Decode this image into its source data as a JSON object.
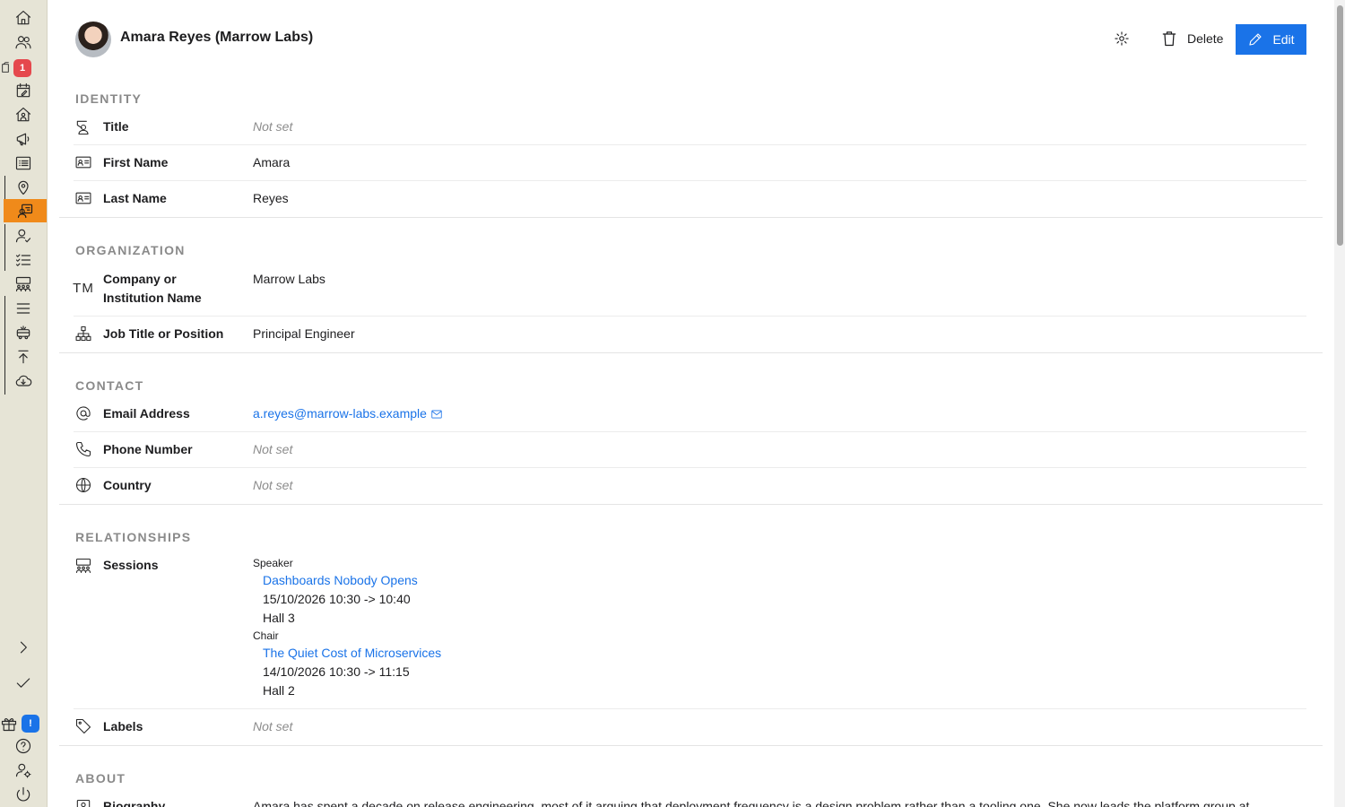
{
  "sidebar": {
    "badges": {
      "notifications": "1",
      "updates": "!"
    },
    "icons": [
      "home-icon",
      "people-icon",
      "inbox-icon",
      "calendar-edit-icon",
      "house-user-icon",
      "megaphone-icon",
      "list-icon",
      "map-pin-icon",
      "contact-card-icon",
      "user-check-icon",
      "checklist-icon",
      "audience-icon",
      "menu-lines-icon",
      "bus-icon",
      "upload-icon",
      "cloud-download-icon",
      "chevron-right-icon",
      "check-icon",
      "gift-icon",
      "help-icon",
      "user-settings-icon",
      "power-icon"
    ]
  },
  "header": {
    "title": "Amara Reyes (Marrow Labs)",
    "delete_label": "Delete",
    "edit_label": "Edit"
  },
  "sections": {
    "identity": {
      "title": "IDENTITY",
      "rows": [
        {
          "label": "Title",
          "value": "Not set",
          "icon": "graduate-icon"
        },
        {
          "label": "First Name",
          "value": "Amara",
          "icon": "id-card-icon"
        },
        {
          "label": "Last Name",
          "value": "Reyes",
          "icon": "id-card-icon"
        }
      ]
    },
    "organization": {
      "title": "ORGANIZATION",
      "rows": [
        {
          "label": "Company or Institution Name",
          "value": "Marrow Labs",
          "icon": "trademark-icon",
          "icon_text": "TM"
        },
        {
          "label": "Job Title or Position",
          "value": "Principal Engineer",
          "icon": "org-chart-icon"
        }
      ]
    },
    "contact": {
      "title": "CONTACT",
      "rows": [
        {
          "label": "Email Address",
          "value": "a.reyes@marrow-labs.example",
          "icon": "at-icon"
        },
        {
          "label": "Phone Number",
          "value": "Not set",
          "icon": "phone-icon"
        },
        {
          "label": "Country",
          "value": "Not set",
          "icon": "globe-icon"
        }
      ]
    },
    "relationships": {
      "title": "RELATIONSHIPS",
      "sessions": {
        "label": "Sessions",
        "groups": [
          {
            "role": "Speaker",
            "title": "Dashboards Nobody Opens",
            "time": "15/10/2026 10:30 -> 10:40",
            "room": "Hall 3"
          },
          {
            "role": "Chair",
            "title": "The Quiet Cost of Microservices",
            "time": "14/10/2026 10:30 -> 11:15",
            "room": "Hall 2"
          }
        ]
      },
      "labels": {
        "label": "Labels",
        "value": "Not set"
      }
    },
    "about": {
      "title": "ABOUT",
      "biography_label": "Biography",
      "biography": "Amara has spent a decade on release engineering, most of it arguing that deployment frequency is a design problem rather than a tooling one. She now leads the platform group at"
    }
  }
}
